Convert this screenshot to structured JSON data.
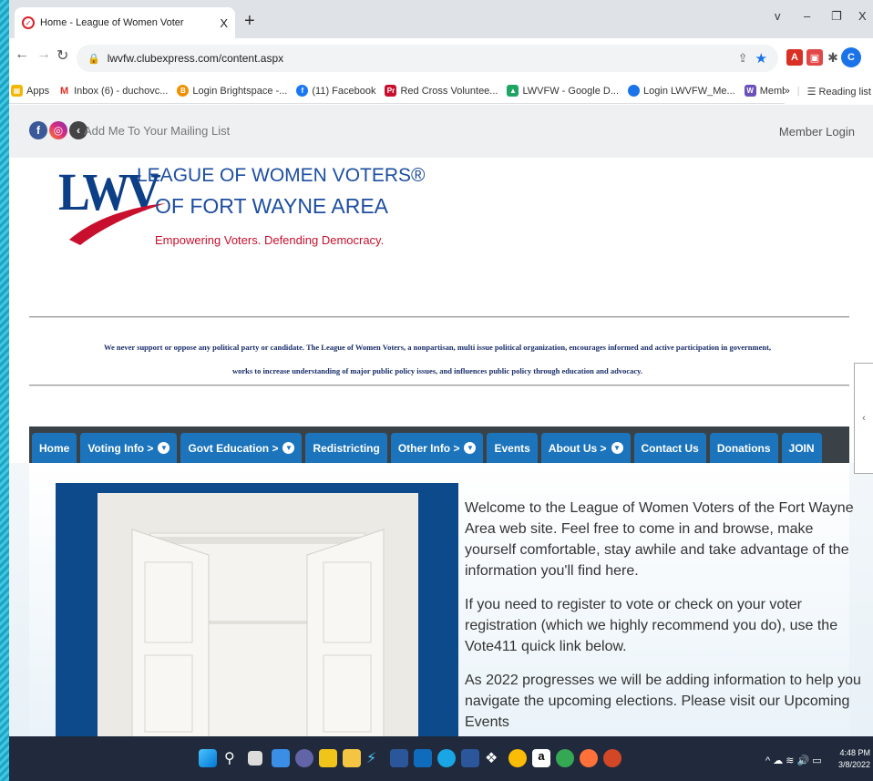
{
  "browser": {
    "tab_title": "Home - League of Women Voter",
    "tab_close": "X",
    "new_tab": "+",
    "window_controls": [
      "v",
      "–",
      "❐",
      "X"
    ],
    "url": "lwvfw.clubexpress.com/content.aspx"
  },
  "bookmarks": [
    {
      "label": "Apps",
      "icon": "apps-grid-icon",
      "color": "#e8453c"
    },
    {
      "label": "Inbox (6) - duchovc...",
      "icon": "gmail-icon",
      "color": "#d93025"
    },
    {
      "label": "Login Brightspace -...",
      "icon": "brightspace-icon",
      "color": "#f29100"
    },
    {
      "label": "(11) Facebook",
      "icon": "facebook-icon",
      "color": "#1877f2"
    },
    {
      "label": "Red Cross Voluntee...",
      "icon": "redcross-icon",
      "color": "#c8102e"
    },
    {
      "label": "LWVFW - Google D...",
      "icon": "google-drive-icon",
      "color": "#1fa463"
    },
    {
      "label": "Login LWVFW_Me...",
      "icon": "bookmark-blue-icon",
      "color": "#1a73e8"
    },
    {
      "label": "Membership & Lea...",
      "icon": "bookmark-purple-icon",
      "color": "#6b4fbb"
    }
  ],
  "bookmarks_more": "»",
  "reading_list": "Reading list",
  "site": {
    "mailing_list": "Add Me To Your Mailing List",
    "member_login": "Member Login",
    "logo_mark": "LWV",
    "logo_line1": "LEAGUE OF WOMEN VOTERS®",
    "logo_line2": "OF FORT WAYNE AREA",
    "tagline": "Empowering Voters.  Defending Democracy.",
    "mission_line1": "We never support or oppose any political party or candidate. The League of Women Voters, a nonpartisan, multi issue political organization, encourages informed and active participation in government,",
    "mission_line2": "works to increase understanding of major public policy issues, and influences public policy through education and advocacy.",
    "nav": [
      {
        "label": "Home",
        "dropdown": false
      },
      {
        "label": "Voting Info >",
        "dropdown": true
      },
      {
        "label": "Govt Education >",
        "dropdown": true
      },
      {
        "label": "Redistricting",
        "dropdown": false
      },
      {
        "label": "Other Info >",
        "dropdown": true
      },
      {
        "label": "Events",
        "dropdown": false
      },
      {
        "label": "About Us >",
        "dropdown": true
      },
      {
        "label": "Contact Us",
        "dropdown": false
      },
      {
        "label": "Donations",
        "dropdown": false
      },
      {
        "label": "JOIN",
        "dropdown": false
      }
    ],
    "para1": "Welcome to the League of Women Voters of the Fort Wayne Area web site. Feel free to come in and browse, make yourself comfortable, stay awhile and take advantage of the information you'll find here.",
    "para2": "If you need to register to vote or check on your voter registration (which we highly recommend you do), use the Vote411 quick link below.",
    "para3": "As 2022 progresses we will be adding information to help you navigate the upcoming elections. Please visit our Upcoming Events"
  },
  "taskbar": {
    "time": "4:48 PM",
    "date": "3/8/2022"
  },
  "colors": {
    "nav_bar": "#3a4247",
    "nav_item": "#1c75bc",
    "logo_blue": "#0c3f86",
    "logo_red": "#c8102e"
  }
}
